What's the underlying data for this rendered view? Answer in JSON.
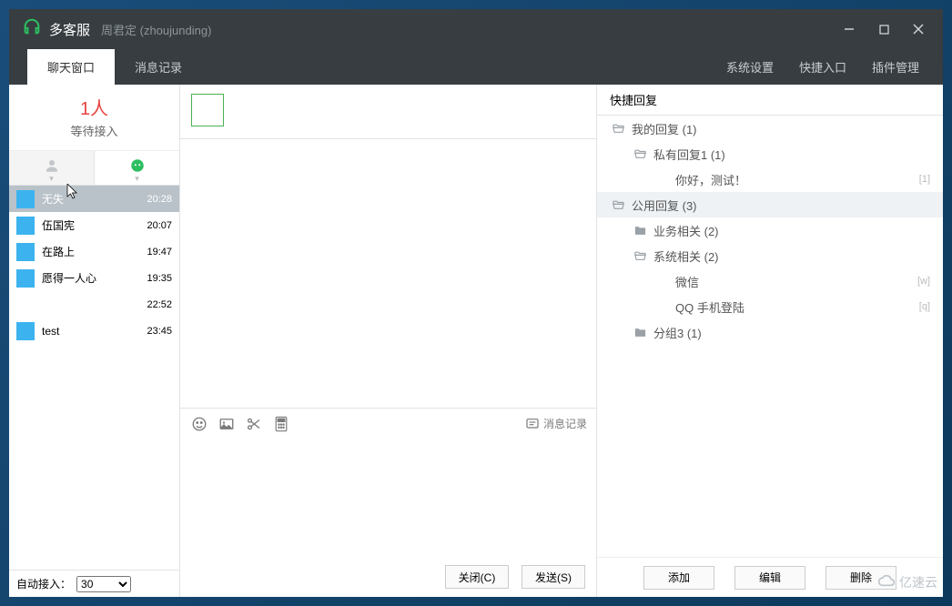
{
  "header": {
    "app_title": "多客服",
    "user_display": "周君定 (zhoujunding)"
  },
  "tabs": {
    "chat_window": "聊天窗口",
    "message_log": "消息记录",
    "system_settings": "系统设置",
    "quick_entry": "快捷入口",
    "plugin_mgmt": "插件管理"
  },
  "waiting": {
    "count": "1人",
    "label": "等待接入"
  },
  "contacts": [
    {
      "name": "无失",
      "time": "20:28",
      "avatar": "av1"
    },
    {
      "name": "伍国宪",
      "time": "20:07",
      "avatar": "av2"
    },
    {
      "name": "在路上",
      "time": "19:47",
      "avatar": "av3"
    },
    {
      "name": "愿得一人心",
      "time": "19:35",
      "avatar": "av4"
    },
    {
      "name": "",
      "time": "22:52",
      "avatar": "av5"
    },
    {
      "name": "test",
      "time": "23:45",
      "avatar": "av6"
    }
  ],
  "auto_accept": {
    "label": "自动接入：",
    "value": "30"
  },
  "toolbar": {
    "history_label": "消息记录"
  },
  "buttons": {
    "close": "关闭(C)",
    "send": "发送(S)",
    "add": "添加",
    "edit": "编辑",
    "delete": "删除"
  },
  "quick_reply": {
    "title": "快捷回复",
    "tree": [
      {
        "indent": 1,
        "icon": "folder-open",
        "label": "我的回复 (1)",
        "shortcut": ""
      },
      {
        "indent": 2,
        "icon": "folder-open",
        "label": "私有回复1 (1)",
        "shortcut": ""
      },
      {
        "indent": 3,
        "icon": "",
        "label": "你好，测试！",
        "shortcut": "[1]"
      },
      {
        "indent": 1,
        "icon": "folder-open",
        "label": "公用回复 (3)",
        "shortcut": "",
        "selected": true
      },
      {
        "indent": 2,
        "icon": "folder",
        "label": "业务相关 (2)",
        "shortcut": ""
      },
      {
        "indent": 2,
        "icon": "folder-open",
        "label": "系统相关 (2)",
        "shortcut": ""
      },
      {
        "indent": 3,
        "icon": "",
        "label": "微信",
        "shortcut": "[w]"
      },
      {
        "indent": 3,
        "icon": "",
        "label": "QQ 手机登陆",
        "shortcut": "[q]"
      },
      {
        "indent": 2,
        "icon": "folder",
        "label": "分组3 (1)",
        "shortcut": ""
      }
    ]
  },
  "watermark": "亿速云"
}
